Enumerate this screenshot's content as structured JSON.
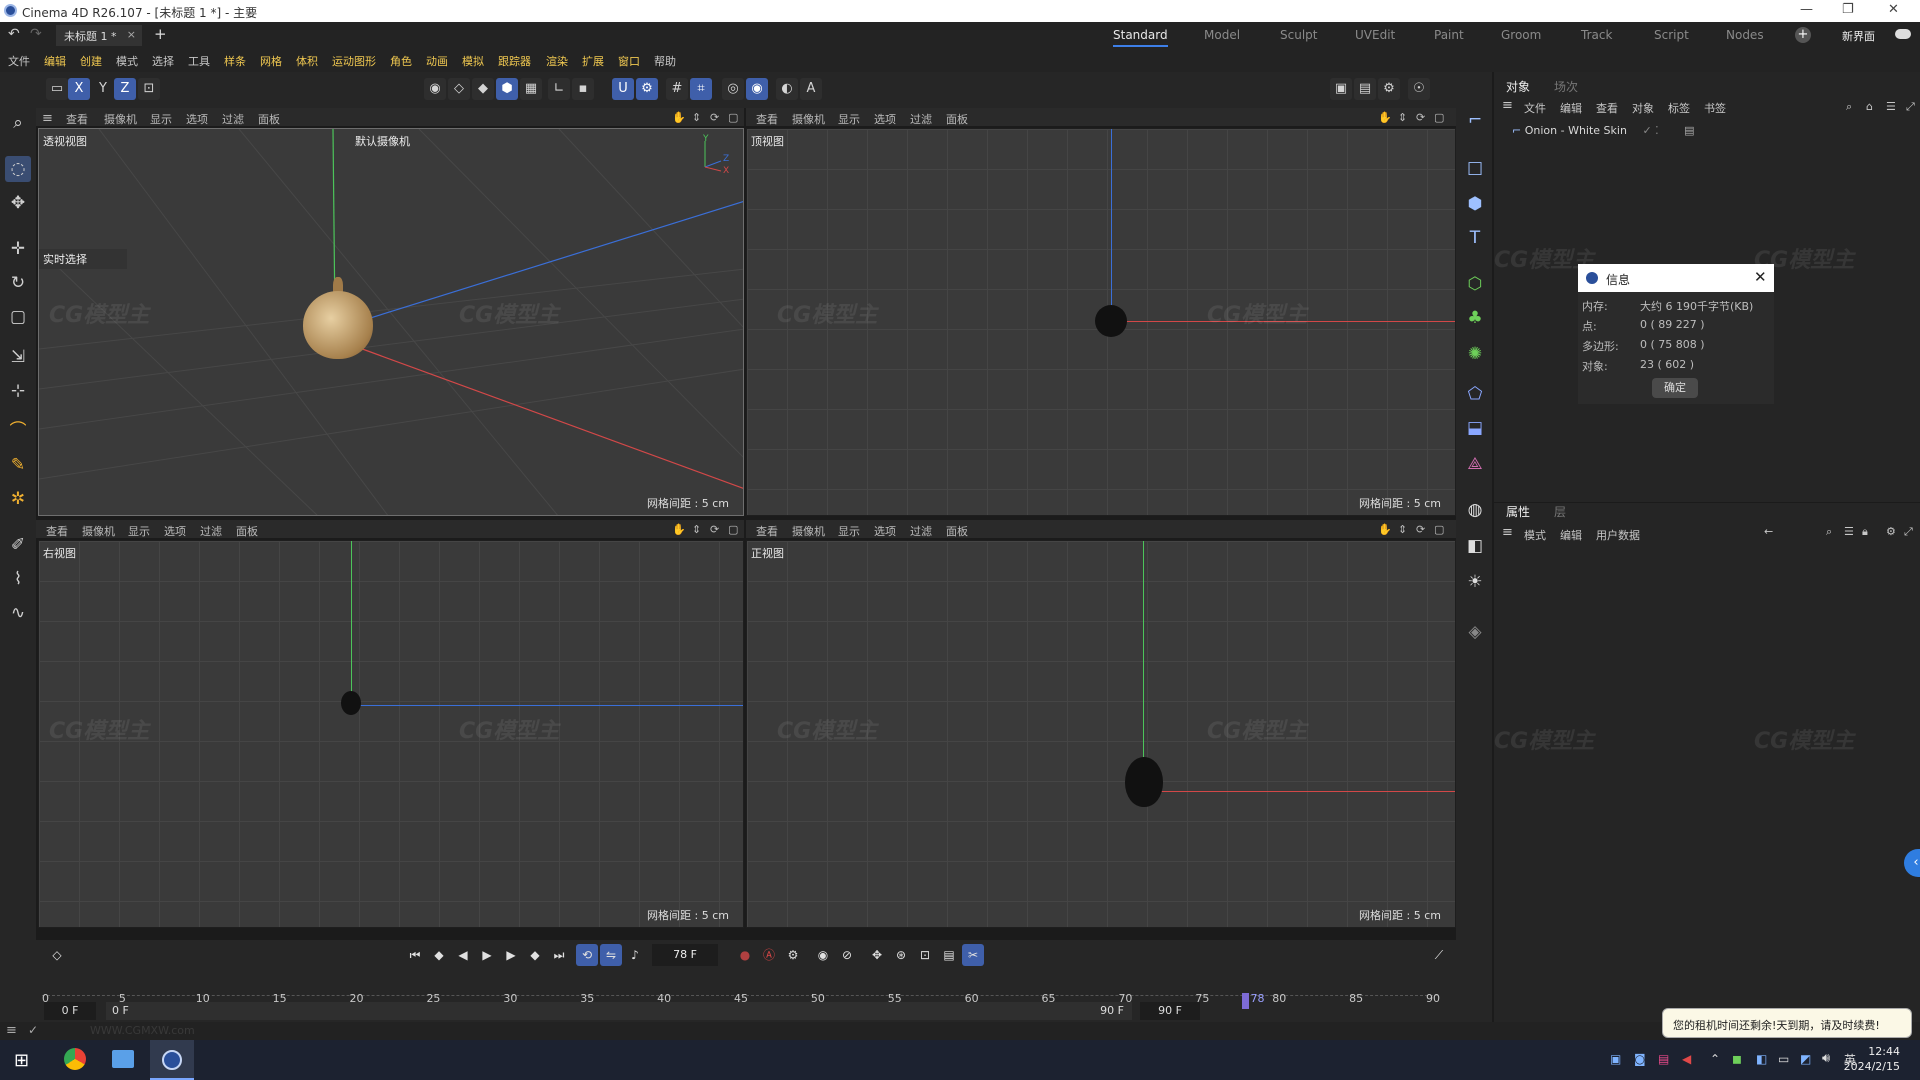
{
  "window": {
    "title": "Cinema 4D R26.107 - [未标题 1 *] - 主要",
    "controls": [
      "—",
      "❐",
      "✕"
    ]
  },
  "tabbar": {
    "undo_icon": "undo-icon",
    "redo_icon": "redo-icon",
    "doc_tab": "未标题 1 *",
    "add_tab": "+",
    "layouts": [
      "Standard",
      "Model",
      "Sculpt",
      "UVEdit",
      "Paint",
      "Groom",
      "Track",
      "Script",
      "Nodes"
    ],
    "active_layout": "Standard",
    "new_interface": "新界面"
  },
  "menubar": {
    "items": [
      "文件",
      "编辑",
      "创建",
      "模式",
      "选择",
      "工具",
      "样条",
      "网格",
      "体积",
      "运动图形",
      "角色",
      "动画",
      "模拟",
      "跟踪器",
      "渲染",
      "扩展",
      "窗口",
      "帮助"
    ]
  },
  "viewport_menu": [
    "查看",
    "摄像机",
    "显示",
    "选项",
    "过滤",
    "面板"
  ],
  "viewports": {
    "perspective": {
      "title": "透视视图",
      "camera": "默认摄像机",
      "live_select": "实时选择",
      "grid": "网格间距 : 5 cm"
    },
    "top": {
      "title": "顶视图",
      "grid": "网格间距 : 5 cm"
    },
    "right": {
      "title": "右视图",
      "grid": "网格间距 : 5 cm"
    },
    "front": {
      "title": "正视图",
      "grid": "网格间距 : 5 cm"
    }
  },
  "watermark": "CG模型主",
  "watermark_url": "WWW.CGMXW.com",
  "objects_panel": {
    "tabs": [
      "对象",
      "场次"
    ],
    "menu": [
      "文件",
      "编辑",
      "查看",
      "对象",
      "标签",
      "书签"
    ],
    "object_name": "Onion - White Skin"
  },
  "info_dialog": {
    "title": "信息",
    "labels": [
      "内存:",
      "点:",
      "多边形:",
      "对象:"
    ],
    "values": [
      "大约 6 190千字节(KB)",
      "0 ( 89 227 )",
      "0 ( 75 808 )",
      "23 ( 602 )"
    ],
    "ok": "确定"
  },
  "attributes_panel": {
    "tabs": [
      "属性",
      "层"
    ],
    "menu": [
      "模式",
      "编辑",
      "用户数据"
    ]
  },
  "timeline": {
    "current_frame": "78 F",
    "ticks": [
      "0",
      "5",
      "10",
      "15",
      "20",
      "25",
      "30",
      "35",
      "40",
      "45",
      "50",
      "55",
      "60",
      "65",
      "70",
      "75",
      "80",
      "85",
      "90"
    ],
    "playhead": "78",
    "playhead_fraction": 0.8667,
    "range_start": "0 F",
    "range_start2": "0 F",
    "range_end": "90 F",
    "range_end2": "90 F"
  },
  "notification": "您的租机时间还剩余!天到期，请及时续费!",
  "taskbar": {
    "time": "12:44",
    "date": "2024/2/15",
    "ime": "英"
  },
  "colors": {
    "accent": "#3d7fe8",
    "axis_x": "#d24848",
    "axis_y": "#4cc45a",
    "axis_z": "#3a6fd8"
  }
}
